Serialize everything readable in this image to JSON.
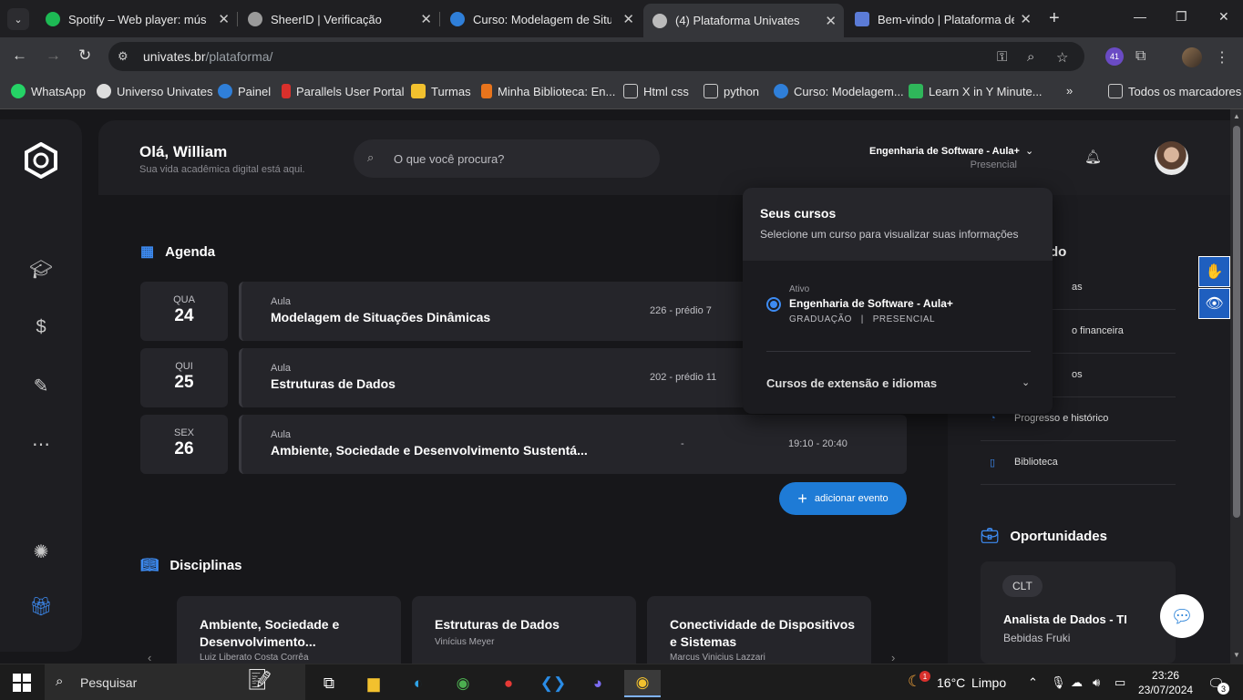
{
  "browser": {
    "tabs": [
      {
        "title": "Spotify – Web player: música",
        "fav_color": "#1db954"
      },
      {
        "title": "SheerID | Verificação",
        "fav_color": "#9a9a9a"
      },
      {
        "title": "Curso: Modelagem de Situaç",
        "fav_color": "#2f7fd9"
      },
      {
        "title": "(4) Plataforma Univates",
        "fav_color": "#bbbbbb"
      },
      {
        "title": "Bem-vindo | Plataforma de C",
        "fav_color": "#5b7bd6"
      }
    ],
    "url_domain": "univates.br",
    "url_path": "/plataforma/",
    "extension_badge": "41",
    "bookmarks": [
      {
        "label": "WhatsApp",
        "color": "#25d366"
      },
      {
        "label": "Universo Univates",
        "color": "#dddddd"
      },
      {
        "label": "Painel",
        "color": "#2f7fd9"
      },
      {
        "label": "Parallels User Portal",
        "color": "#d9302c"
      },
      {
        "label": "Turmas",
        "color": "#f2c12e"
      },
      {
        "label": "Minha Biblioteca: En...",
        "color": "#e8741c"
      },
      {
        "label": "Html css",
        "color": "#cccccc"
      },
      {
        "label": "python",
        "color": "#cccccc"
      },
      {
        "label": "Curso: Modelagem...",
        "color": "#2f7fd9"
      },
      {
        "label": "Learn X in Y Minute...",
        "color": "#2fb65a"
      }
    ],
    "bookmarks_all": "Todos os marcadores"
  },
  "header": {
    "greeting": "Olá, William",
    "subtitle": "Sua vida acadêmica digital está aqui.",
    "search_placeholder": "O que você procura?",
    "course_selected": "Engenharia de Software - Aula+",
    "course_mode": "Presencial"
  },
  "agenda": {
    "title": "Agenda",
    "events": [
      {
        "weekday": "QUA",
        "day": "24",
        "type": "Aula",
        "name": "Modelagem de Situações Dinâmicas",
        "room": "226 - prédio 7",
        "time": ""
      },
      {
        "weekday": "QUI",
        "day": "25",
        "type": "Aula",
        "name": "Estruturas de Dados",
        "room": "202 - prédio 11",
        "time": ""
      },
      {
        "weekday": "SEX",
        "day": "26",
        "type": "Aula",
        "name": "Ambiente, Sociedade e Desenvolvimento Sustentá...",
        "room": "-",
        "time": "19:10 - 20:40"
      }
    ],
    "add_button": "adicionar evento"
  },
  "disciplinas": {
    "title": "Disciplinas",
    "cards": [
      {
        "name": "Ambiente, Sociedade e Desenvolvimento...",
        "professor": "Luiz Liberato Costa Corrêa"
      },
      {
        "name": "Estruturas de Dados",
        "professor": "Vinícius Meyer"
      },
      {
        "name": "Conectividade de Dispositivos e Sistemas",
        "professor": "Marcus Vinicius Lazzari"
      }
    ]
  },
  "right_column": {
    "title_partial": "do",
    "items": [
      {
        "label": "as"
      },
      {
        "label": "o financeira"
      },
      {
        "label": "os"
      },
      {
        "label": "Progresso e histórico"
      },
      {
        "label": "Biblioteca"
      }
    ],
    "opportunities_title": "Oportunidades",
    "opportunity": {
      "tag": "CLT",
      "title": "Analista de Dados - TI",
      "company": "Bebidas Fruki"
    }
  },
  "dropdown": {
    "title": "Seus cursos",
    "subtitle": "Selecione um curso para visualizar suas informações",
    "option_status": "Ativo",
    "option_name": "Engenharia de Software - Aula+",
    "option_level": "GRADUAÇÃO",
    "option_sep": "|",
    "option_mode": "PRESENCIAL",
    "extension_label": "Cursos de extensão e idiomas"
  },
  "taskbar": {
    "search": "Pesquisar",
    "weather_temp": "16°C",
    "weather_text": "Limpo",
    "weather_badge": "1",
    "time": "23:26",
    "date": "23/07/2024",
    "notif_count": "3"
  },
  "colors": {
    "accent": "#3d8bf2",
    "button_blue": "#1e7bd6",
    "page_bg": "#17171a",
    "card_bg": "#25252a"
  }
}
